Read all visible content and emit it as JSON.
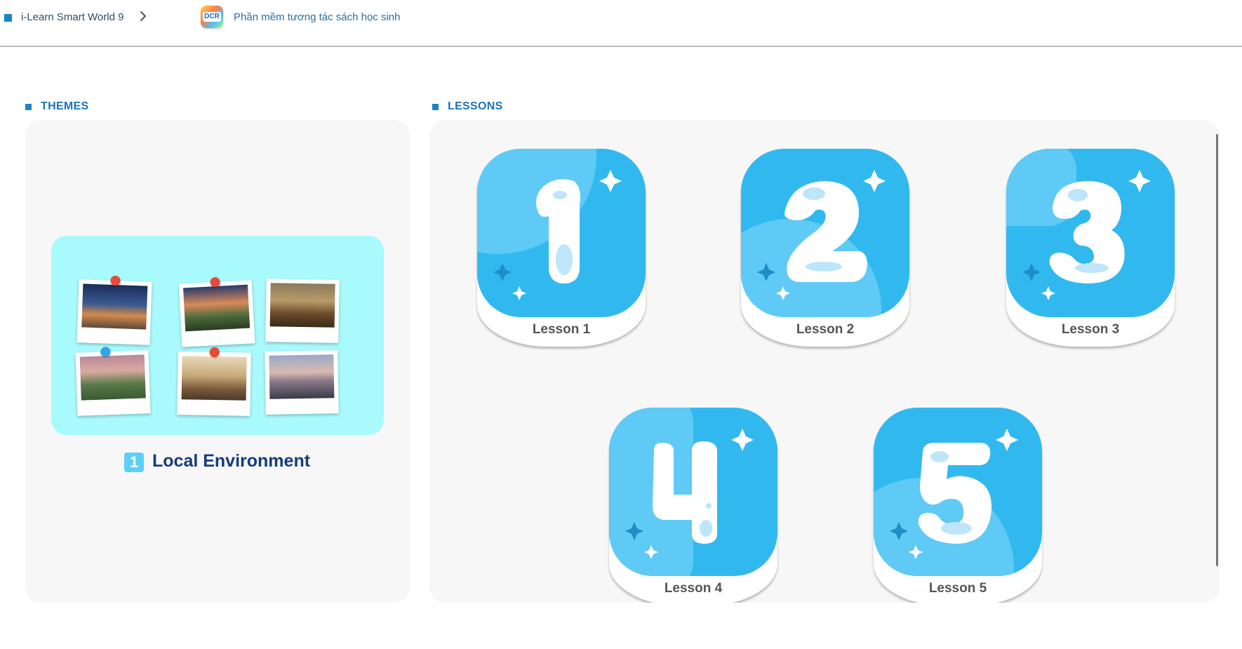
{
  "header": {
    "breadcrumb": "i-Learn Smart World 9",
    "app_logo_text": "DCR",
    "app_name": "Phần mềm tương tác sách học sinh"
  },
  "themes": {
    "section_title": "THEMES",
    "items": [
      {
        "number": "1",
        "title": "Local Environment"
      }
    ]
  },
  "lessons": {
    "section_title": "LESSONS",
    "items": [
      {
        "number": "1",
        "label": "Lesson 1"
      },
      {
        "number": "2",
        "label": "Lesson 2"
      },
      {
        "number": "3",
        "label": "Lesson 3"
      },
      {
        "number": "4",
        "label": "Lesson 4"
      },
      {
        "number": "5",
        "label": "Lesson 5"
      }
    ]
  },
  "colors": {
    "accent": "#1a84c7",
    "tile_blue": "#31b9ef",
    "theme_card": "#a9fafd",
    "theme_title": "#153c78"
  }
}
